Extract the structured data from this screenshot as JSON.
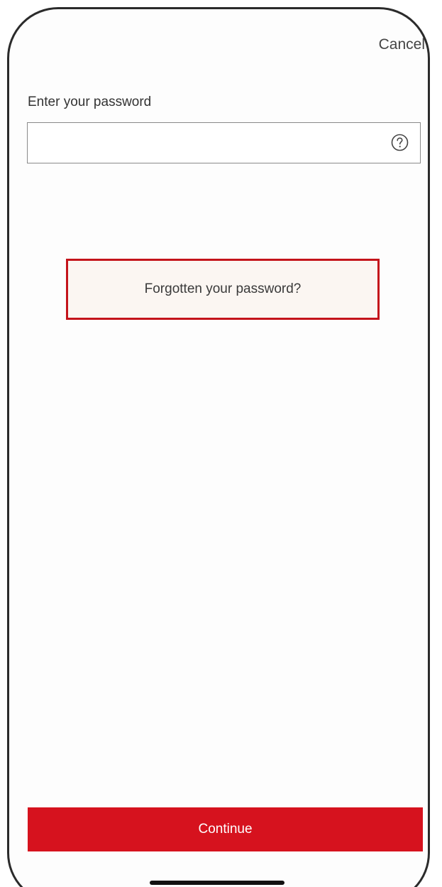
{
  "header": {
    "cancel_label": "Cancel"
  },
  "password": {
    "label": "Enter your password",
    "value": "",
    "help_icon": "question-circle-icon"
  },
  "forgot": {
    "label": "Forgotten your password?"
  },
  "footer": {
    "continue_label": "Continue"
  },
  "colors": {
    "primary": "#d6121e",
    "highlight_border": "#c4141b",
    "highlight_fill": "#fbf6f2"
  }
}
